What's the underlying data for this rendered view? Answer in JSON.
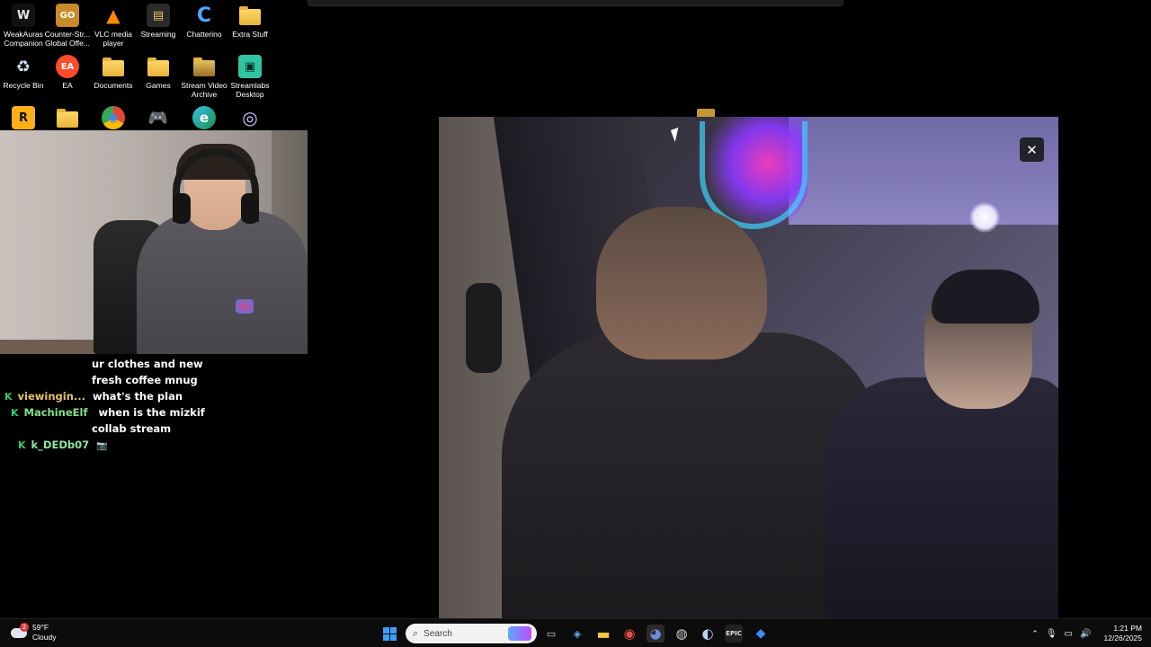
{
  "desktop": {
    "icons": [
      {
        "label": "WeakAuras Companion",
        "icon": "weakauras-icon",
        "glyph": "W"
      },
      {
        "label": "Counter-Str... Global Offe...",
        "icon": "csgo-icon",
        "glyph": "GO"
      },
      {
        "label": "VLC media player",
        "icon": "vlc-icon",
        "glyph": "▲"
      },
      {
        "label": "Streaming",
        "icon": "streaming-icon",
        "glyph": "▤"
      },
      {
        "label": "Chatterino",
        "icon": "chatterino-icon",
        "glyph": "C"
      },
      {
        "label": "Extra Stuff",
        "icon": "folder-icon",
        "glyph": ""
      },
      {
        "label": "Recycle Bin",
        "icon": "recycle-bin-icon",
        "glyph": "♻"
      },
      {
        "label": "EA",
        "icon": "ea-icon",
        "glyph": "EA"
      },
      {
        "label": "Documents",
        "icon": "folder-icon",
        "glyph": ""
      },
      {
        "label": "Games",
        "icon": "folder-icon",
        "glyph": ""
      },
      {
        "label": "Stream Video Archive",
        "icon": "folder-icon",
        "glyph": ""
      },
      {
        "label": "Streamlabs Desktop",
        "icon": "streamlabs-icon",
        "glyph": "▣"
      },
      {
        "label": "",
        "icon": "rockstar-icon",
        "glyph": "R"
      },
      {
        "label": "",
        "icon": "folder-icon",
        "glyph": ""
      },
      {
        "label": "",
        "icon": "chrome-icon",
        "glyph": "◉"
      },
      {
        "label": "",
        "icon": "gamepad-icon",
        "glyph": "🎮"
      },
      {
        "label": "",
        "icon": "edge-icon",
        "glyph": "e"
      },
      {
        "label": "",
        "icon": "ubisoft-icon",
        "glyph": "◎"
      }
    ]
  },
  "chat": {
    "lines": [
      {
        "badge": "",
        "user": "",
        "user_color": "#ffffff",
        "text": "ur clothes and new"
      },
      {
        "badge": "",
        "user": "",
        "user_color": "#ffffff",
        "text": "fresh coffee mnug"
      },
      {
        "badge": "K",
        "user": "viewingin...",
        "user_color": "#e8c26a",
        "text": "what's the plan"
      },
      {
        "badge": "K",
        "user": "MachineElf",
        "user_color": "#7fe08a",
        "text": "when is the mizkif"
      },
      {
        "badge": "",
        "user": "",
        "user_color": "#ffffff",
        "text": "collab stream"
      },
      {
        "badge": "K",
        "user": "k_DEDb07",
        "user_color": "#8be7a8",
        "text": "📷"
      }
    ]
  },
  "player": {
    "close_glyph": "✕"
  },
  "taskbar": {
    "weather": {
      "temp": "59°F",
      "condition": "Cloudy",
      "badge": "2"
    },
    "search_label": "Search",
    "clock": {
      "time": "1:21 PM",
      "date": "12/26/2025"
    },
    "apps": [
      {
        "icon": "task-view-icon",
        "glyph": "▭",
        "color": "#cfd8e3"
      },
      {
        "icon": "copilot-icon",
        "glyph": "◈",
        "color": "#5ab0ff"
      },
      {
        "icon": "file-explorer-icon",
        "glyph": "▬",
        "color": "#f4c542"
      },
      {
        "icon": "chrome-icon",
        "glyph": "◉",
        "color": "#e94b3c"
      },
      {
        "icon": "discord-icon",
        "glyph": "◕",
        "color": "#7289da"
      },
      {
        "icon": "obs-icon",
        "glyph": "◍",
        "color": "#d0d0d0"
      },
      {
        "icon": "steam-icon",
        "glyph": "◐",
        "color": "#b7d3f0"
      },
      {
        "icon": "epic-games-icon",
        "glyph": "EPIC",
        "color": "#e0e0e0"
      },
      {
        "icon": "app-icon",
        "glyph": "◆",
        "color": "#3a8bff"
      }
    ]
  }
}
